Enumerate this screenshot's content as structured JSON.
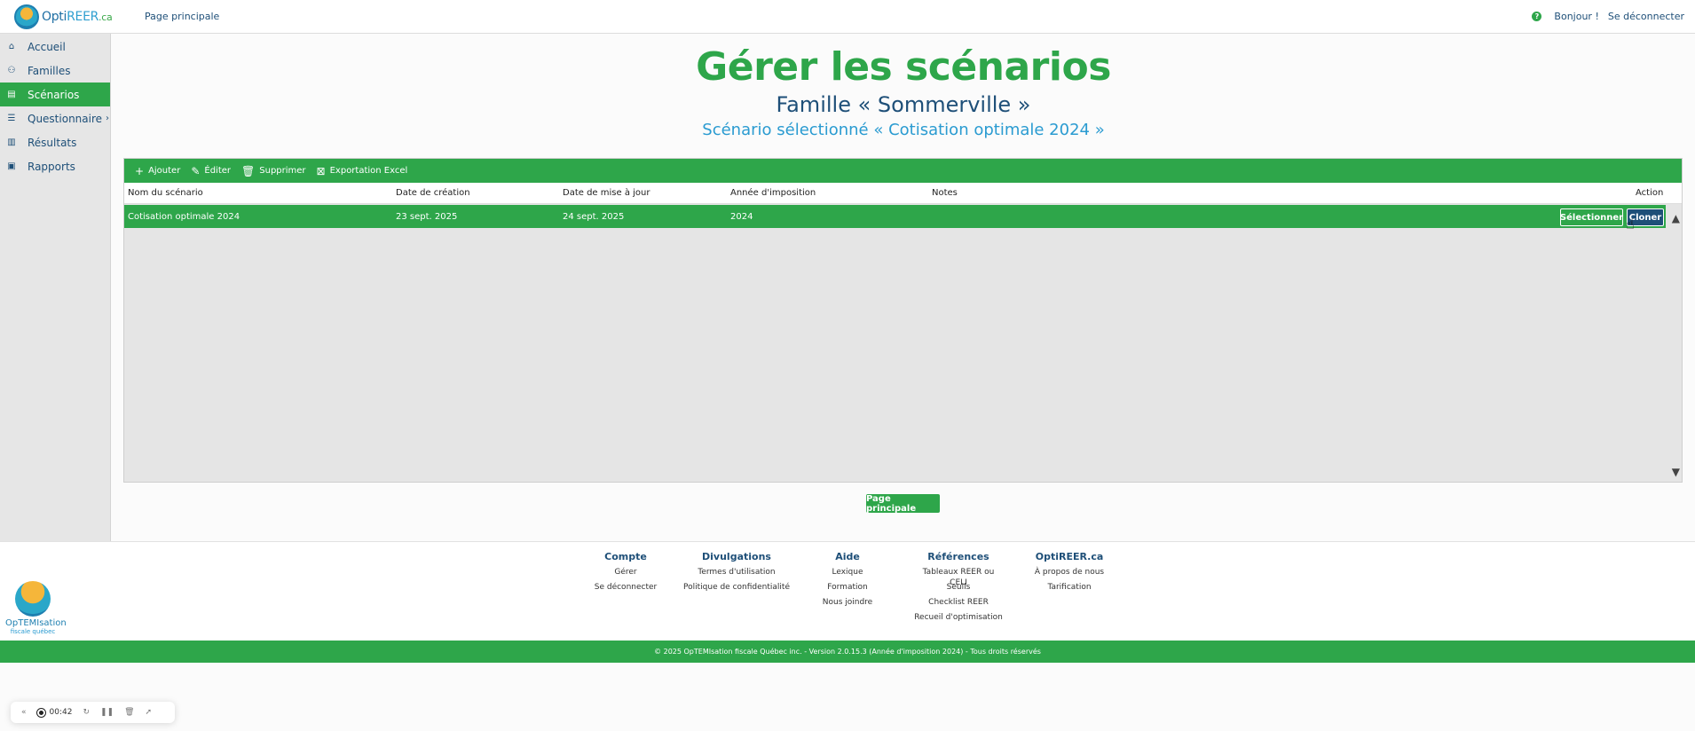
{
  "header": {
    "logo": {
      "prefix": "Opti",
      "mid": "REER",
      "suffix": ".ca"
    },
    "nav_link": "Page principale",
    "greeting": "Bonjour !",
    "logout": "Se déconnecter"
  },
  "sidebar": {
    "items": [
      {
        "label": "Accueil",
        "icon": "home-icon",
        "glyph": "⌂"
      },
      {
        "label": "Familles",
        "icon": "family-icon",
        "glyph": "⚇"
      },
      {
        "label": "Scénarios",
        "icon": "scenario-icon",
        "glyph": "▤"
      },
      {
        "label": "Questionnaire",
        "icon": "questionnaire-icon",
        "glyph": "☰"
      },
      {
        "label": "Résultats",
        "icon": "results-icon",
        "glyph": "▥"
      },
      {
        "label": "Rapports",
        "icon": "report-icon",
        "glyph": "▣"
      }
    ]
  },
  "main": {
    "title": "Gérer les scénarios",
    "family": "Famille « Sommerville »",
    "selected": "Scénario sélectionné « Cotisation optimale 2024 »",
    "toolbar": {
      "add": "Ajouter",
      "edit": "Éditer",
      "delete": "Supprimer",
      "export": "Exportation Excel"
    },
    "columns": [
      "Nom du scénario",
      "Date de création",
      "Date de mise à jour",
      "Année d'imposition",
      "Notes",
      "Action"
    ],
    "rows": [
      {
        "name": "Cotisation optimale 2024",
        "created": "23 sept. 2025",
        "updated": "24 sept. 2025",
        "year": "2024",
        "notes": "",
        "select": "Sélectionner",
        "clone": "Cloner"
      }
    ],
    "main_button": "Page principale"
  },
  "footer": {
    "logo": {
      "line1": "OpTEMIsation",
      "line2": "fiscale québec"
    },
    "columns": [
      {
        "title": "Compte",
        "links": [
          "Gérer",
          "Se déconnecter"
        ]
      },
      {
        "title": "Divulgations",
        "links": [
          "Termes d'utilisation",
          "Politique de confidentialité"
        ]
      },
      {
        "title": "Aide",
        "links": [
          "Lexique",
          "Formation",
          "Nous joindre"
        ]
      },
      {
        "title": "Références",
        "links": [
          "Tableaux REER ou CELI",
          "Seuils",
          "Checklist REER",
          "Recueil d'optimisation"
        ]
      },
      {
        "title": "OptiREER.ca",
        "links": [
          "À propos de nous",
          "Tarification"
        ]
      }
    ],
    "copyright": "© 2025 OpTEMIsation fiscale Québec inc. - Version 2.0.15.3 (Année d'imposition 2024) - Tous droits réservés"
  },
  "recorder": {
    "time": "00:42"
  },
  "colors": {
    "accent": "#2ea64a",
    "navy": "#1e4f78",
    "blue": "#2a9bd1"
  }
}
